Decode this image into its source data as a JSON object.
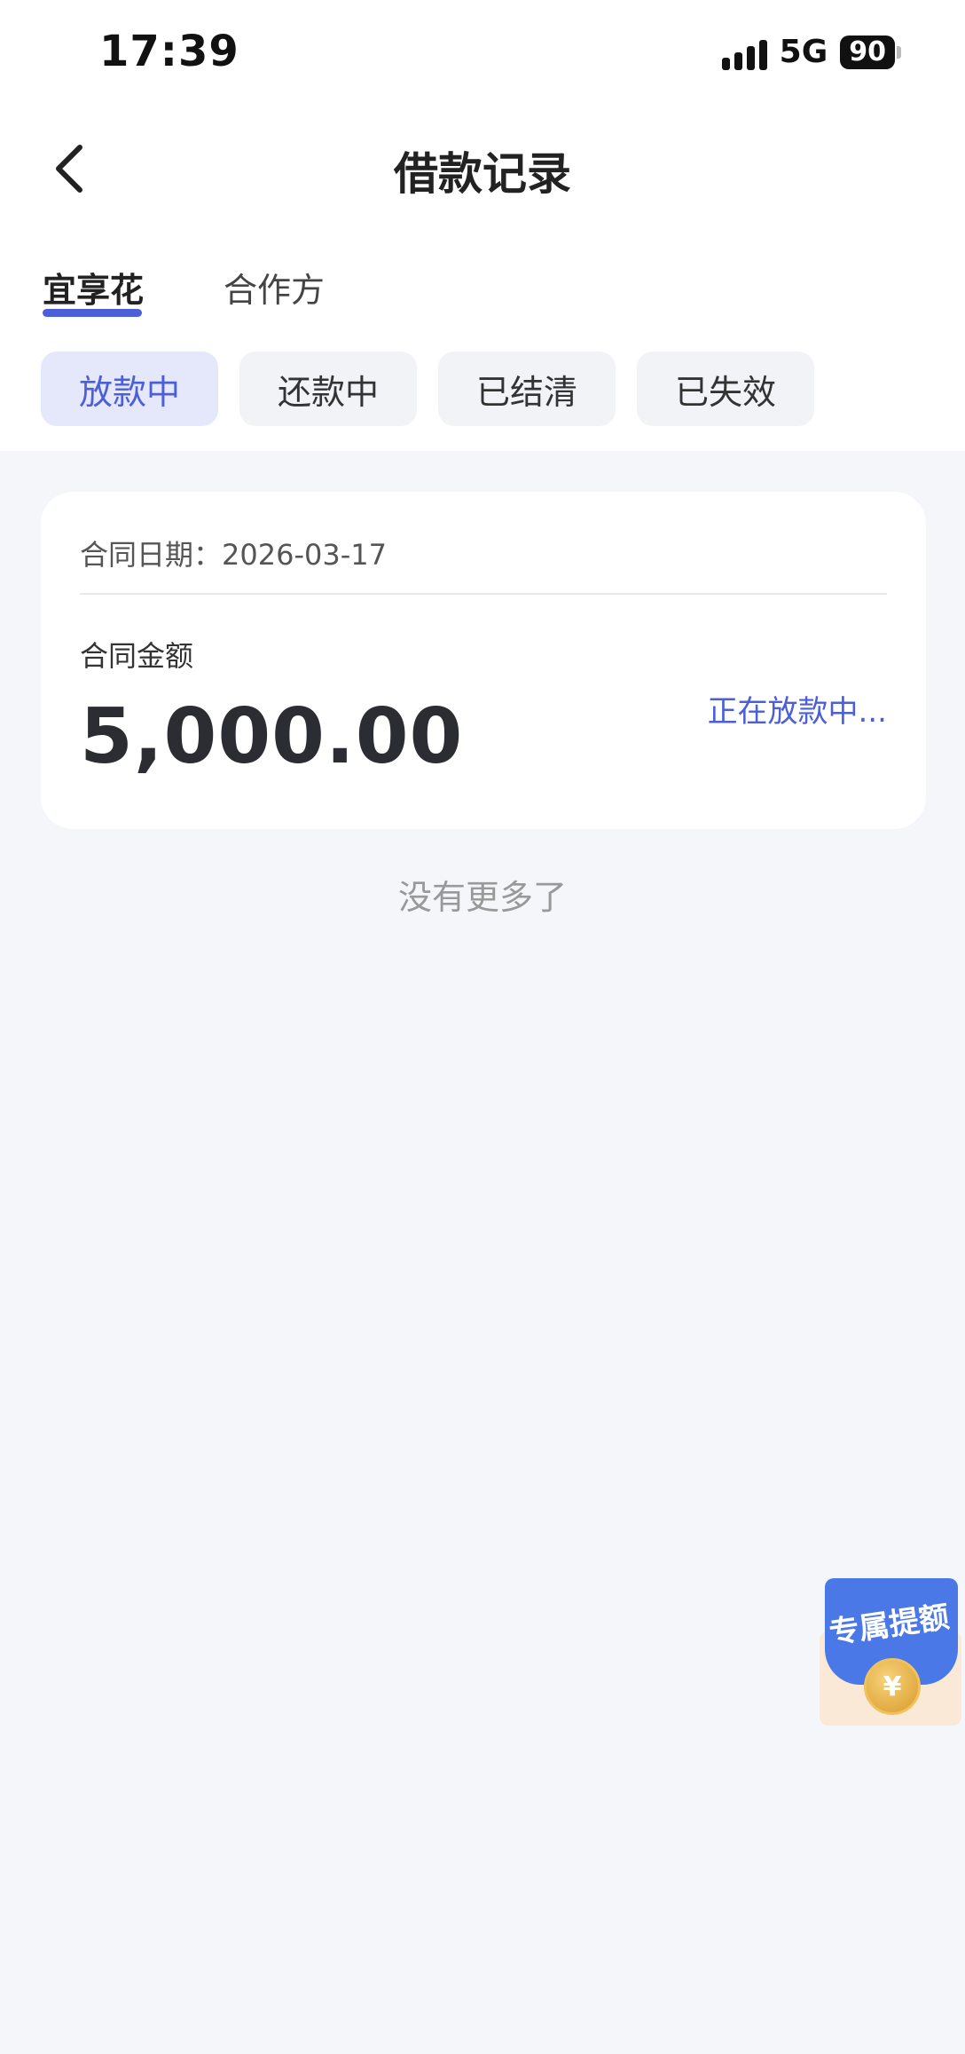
{
  "status_bar": {
    "time": "17:39",
    "network": "5G",
    "battery": "90"
  },
  "header": {
    "title": "借款记录"
  },
  "provider_tabs": [
    {
      "label": "宜享花",
      "active": true
    },
    {
      "label": "合作方",
      "active": false
    }
  ],
  "status_chips": [
    {
      "label": "放款中",
      "active": true
    },
    {
      "label": "还款中",
      "active": false
    },
    {
      "label": "已结清",
      "active": false
    },
    {
      "label": "已失效",
      "active": false
    }
  ],
  "loan_card": {
    "date_label": "合同日期：2026-03-17",
    "amount_label": "合同金额",
    "amount": "5,000.00",
    "status": "正在放款中..."
  },
  "list_footer": "没有更多了",
  "float_badge": {
    "text": "专属提额",
    "coin_symbol": "¥"
  },
  "colors": {
    "accent": "#4c5fd9",
    "page_bg": "#f5f6fa",
    "badge_blue": "#4a78e6"
  }
}
